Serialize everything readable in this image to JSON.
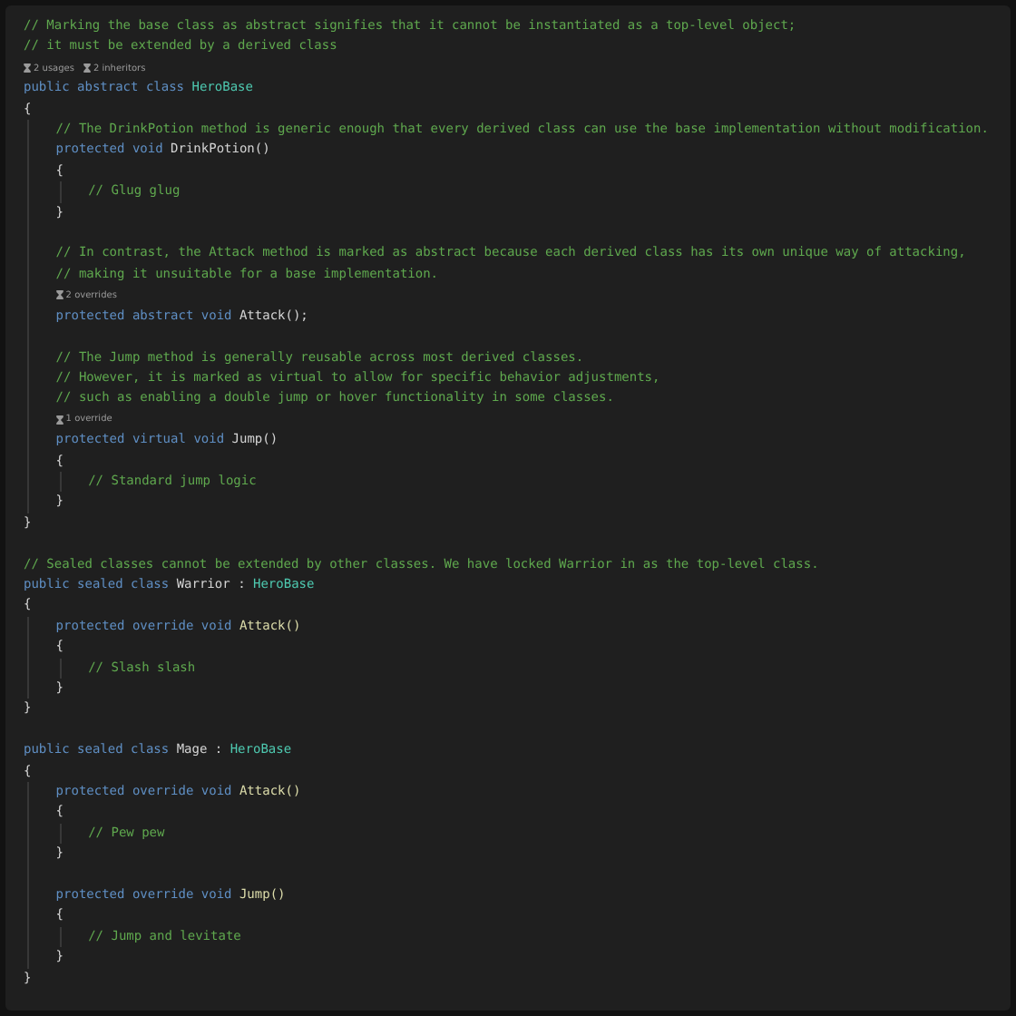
{
  "editor": {
    "lines": [
      {
        "kind": "code",
        "tokens": [
          {
            "kind": "comment",
            "text": "// Marking the base class as abstract signifies that it cannot be instantiated as a top-level object;"
          }
        ]
      },
      {
        "kind": "code",
        "tokens": [
          {
            "kind": "comment",
            "text": "// it must be extended by a derived class"
          }
        ]
      },
      {
        "kind": "hint",
        "items": [
          "2 usages",
          "2 inheritors"
        ]
      },
      {
        "kind": "code",
        "tokens": [
          {
            "kind": "keyword",
            "text": "public"
          },
          {
            "kind": "keyword",
            "text": "abstract"
          },
          {
            "kind": "keyword",
            "text": "class"
          },
          {
            "kind": "class",
            "text": "HeroBase"
          }
        ]
      },
      {
        "kind": "code",
        "tokens": [
          {
            "kind": "plain",
            "text": "{"
          }
        ]
      },
      {
        "kind": "block",
        "children": [
          {
            "kind": "code",
            "tokens": [
              {
                "kind": "comment",
                "text": "// The DrinkPotion method is generic enough that every derived class can use the base implementation without modification."
              }
            ]
          },
          {
            "kind": "code",
            "tokens": [
              {
                "kind": "keyword",
                "text": "protected"
              },
              {
                "kind": "keyword",
                "text": "void"
              },
              {
                "kind": "plain",
                "text": "DrinkPotion()"
              }
            ]
          },
          {
            "kind": "code",
            "tokens": [
              {
                "kind": "plain",
                "text": "{"
              }
            ]
          },
          {
            "kind": "block",
            "children": [
              {
                "kind": "code",
                "tokens": [
                  {
                    "kind": "comment",
                    "text": "// Glug glug"
                  }
                ]
              }
            ]
          },
          {
            "kind": "code",
            "tokens": [
              {
                "kind": "plain",
                "text": "}"
              }
            ]
          },
          {
            "kind": "blank"
          },
          {
            "kind": "code",
            "tokens": [
              {
                "kind": "comment",
                "text": "// In contrast, the Attack method is marked as abstract because each derived class has its own unique way of attacking,"
              }
            ]
          },
          {
            "kind": "code",
            "tokens": [
              {
                "kind": "comment",
                "text": "// making it unsuitable for a base implementation."
              }
            ]
          },
          {
            "kind": "hint",
            "items": [
              "2 overrides"
            ]
          },
          {
            "kind": "code",
            "tokens": [
              {
                "kind": "keyword",
                "text": "protected"
              },
              {
                "kind": "keyword",
                "text": "abstract"
              },
              {
                "kind": "keyword",
                "text": "void"
              },
              {
                "kind": "plain",
                "text": "Attack();"
              }
            ]
          },
          {
            "kind": "blank"
          },
          {
            "kind": "code",
            "tokens": [
              {
                "kind": "comment",
                "text": "// The Jump method is generally reusable across most derived classes."
              }
            ]
          },
          {
            "kind": "code",
            "tokens": [
              {
                "kind": "comment",
                "text": "// However, it is marked as virtual to allow for specific behavior adjustments,"
              }
            ]
          },
          {
            "kind": "code",
            "tokens": [
              {
                "kind": "comment",
                "text": "// such as enabling a double jump or hover functionality in some classes."
              }
            ]
          },
          {
            "kind": "hint",
            "items": [
              "1 override"
            ]
          },
          {
            "kind": "code",
            "tokens": [
              {
                "kind": "keyword",
                "text": "protected"
              },
              {
                "kind": "keyword",
                "text": "virtual"
              },
              {
                "kind": "keyword",
                "text": "void"
              },
              {
                "kind": "plain",
                "text": "Jump()"
              }
            ]
          },
          {
            "kind": "code",
            "tokens": [
              {
                "kind": "plain",
                "text": "{"
              }
            ]
          },
          {
            "kind": "block",
            "children": [
              {
                "kind": "code",
                "tokens": [
                  {
                    "kind": "comment",
                    "text": "// Standard jump logic"
                  }
                ]
              }
            ]
          },
          {
            "kind": "code",
            "tokens": [
              {
                "kind": "plain",
                "text": "}"
              }
            ]
          }
        ]
      },
      {
        "kind": "code",
        "tokens": [
          {
            "kind": "plain",
            "text": "}"
          }
        ]
      },
      {
        "kind": "blank"
      },
      {
        "kind": "code",
        "tokens": [
          {
            "kind": "comment",
            "text": "// Sealed classes cannot be extended by other classes. We have locked Warrior in as the top-level class."
          }
        ]
      },
      {
        "kind": "code",
        "tokens": [
          {
            "kind": "keyword",
            "text": "public"
          },
          {
            "kind": "keyword",
            "text": "sealed"
          },
          {
            "kind": "keyword",
            "text": "class"
          },
          {
            "kind": "plain",
            "text": "Warrior"
          },
          {
            "kind": "plain",
            "text": ":"
          },
          {
            "kind": "class",
            "text": "HeroBase"
          }
        ]
      },
      {
        "kind": "code",
        "tokens": [
          {
            "kind": "plain",
            "text": "{"
          }
        ]
      },
      {
        "kind": "block",
        "children": [
          {
            "kind": "code",
            "tokens": [
              {
                "kind": "keyword",
                "text": "protected"
              },
              {
                "kind": "keyword",
                "text": "override"
              },
              {
                "kind": "keyword",
                "text": "void"
              },
              {
                "kind": "method",
                "text": "Attack()"
              }
            ]
          },
          {
            "kind": "code",
            "tokens": [
              {
                "kind": "plain",
                "text": "{"
              }
            ]
          },
          {
            "kind": "block",
            "children": [
              {
                "kind": "code",
                "tokens": [
                  {
                    "kind": "comment",
                    "text": "// Slash slash"
                  }
                ]
              }
            ]
          },
          {
            "kind": "code",
            "tokens": [
              {
                "kind": "plain",
                "text": "}"
              }
            ]
          }
        ]
      },
      {
        "kind": "code",
        "tokens": [
          {
            "kind": "plain",
            "text": "}"
          }
        ]
      },
      {
        "kind": "blank"
      },
      {
        "kind": "code",
        "tokens": [
          {
            "kind": "keyword",
            "text": "public"
          },
          {
            "kind": "keyword",
            "text": "sealed"
          },
          {
            "kind": "keyword",
            "text": "class"
          },
          {
            "kind": "plain",
            "text": "Mage"
          },
          {
            "kind": "plain",
            "text": ":"
          },
          {
            "kind": "class",
            "text": "HeroBase"
          }
        ]
      },
      {
        "kind": "code",
        "tokens": [
          {
            "kind": "plain",
            "text": "{"
          }
        ]
      },
      {
        "kind": "block",
        "children": [
          {
            "kind": "code",
            "tokens": [
              {
                "kind": "keyword",
                "text": "protected"
              },
              {
                "kind": "keyword",
                "text": "override"
              },
              {
                "kind": "keyword",
                "text": "void"
              },
              {
                "kind": "method",
                "text": "Attack()"
              }
            ]
          },
          {
            "kind": "code",
            "tokens": [
              {
                "kind": "plain",
                "text": "{"
              }
            ]
          },
          {
            "kind": "block",
            "children": [
              {
                "kind": "code",
                "tokens": [
                  {
                    "kind": "comment",
                    "text": "// Pew pew"
                  }
                ]
              }
            ]
          },
          {
            "kind": "code",
            "tokens": [
              {
                "kind": "plain",
                "text": "}"
              }
            ]
          },
          {
            "kind": "blank"
          },
          {
            "kind": "code",
            "tokens": [
              {
                "kind": "keyword",
                "text": "protected"
              },
              {
                "kind": "keyword",
                "text": "override"
              },
              {
                "kind": "keyword",
                "text": "void"
              },
              {
                "kind": "method",
                "text": "Jump()"
              }
            ]
          },
          {
            "kind": "code",
            "tokens": [
              {
                "kind": "plain",
                "text": "{"
              }
            ]
          },
          {
            "kind": "block",
            "children": [
              {
                "kind": "code",
                "tokens": [
                  {
                    "kind": "comment",
                    "text": "// Jump and levitate"
                  }
                ]
              }
            ]
          },
          {
            "kind": "code",
            "tokens": [
              {
                "kind": "plain",
                "text": "}"
              }
            ]
          }
        ]
      },
      {
        "kind": "code",
        "tokens": [
          {
            "kind": "plain",
            "text": "}"
          }
        ]
      }
    ]
  }
}
